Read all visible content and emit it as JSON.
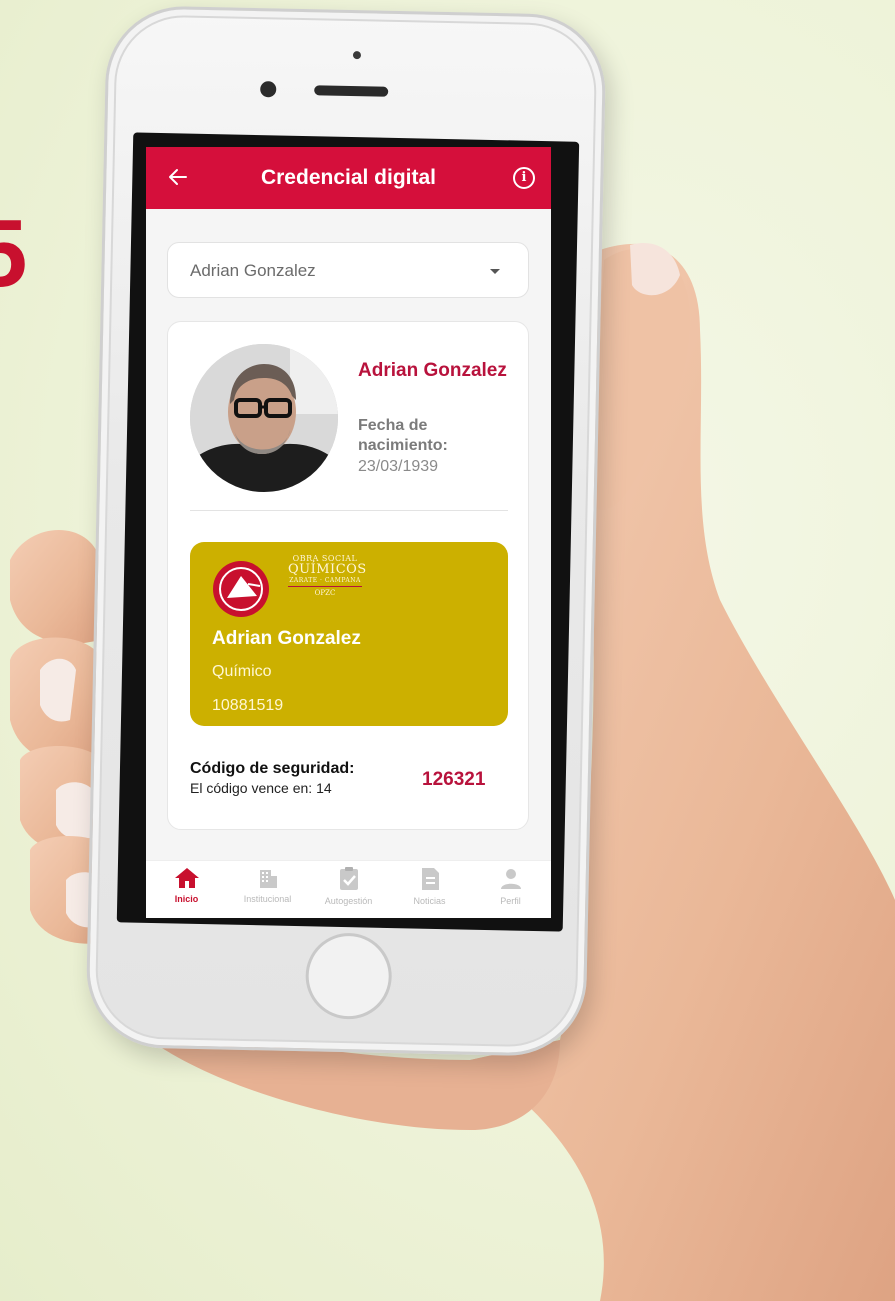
{
  "page": {
    "side_digit": "5"
  },
  "appbar": {
    "title": "Credencial digital",
    "back_icon": "arrow-left-icon",
    "info_icon": "info-icon",
    "info_glyph": "i"
  },
  "member_select": {
    "selected": "Adrian  Gonzalez"
  },
  "profile": {
    "name": "Adrian  Gonzalez",
    "dob_label": "Fecha de nacimiento:",
    "dob_value": "23/03/1939"
  },
  "credential": {
    "logo_line1": "OBRA SOCIAL",
    "logo_line2": "QUÍMICOS",
    "logo_line3": "ZARATE · CAMPANA",
    "logo_line4": "OPZC",
    "name": "Adrian  Gonzalez",
    "role": "Químico",
    "number": "10881519",
    "background_color": "#ccb000"
  },
  "security": {
    "label": "Código de seguridad:",
    "expire_text": "El código vence en: 14",
    "code": "126321"
  },
  "bottom_nav": {
    "items": [
      {
        "label": "Inicio",
        "icon": "home-icon",
        "active": true
      },
      {
        "label": "Institucional",
        "icon": "building-icon",
        "active": false
      },
      {
        "label": "Autogestión",
        "icon": "clipboard-check-icon",
        "active": false
      },
      {
        "label": "Noticias",
        "icon": "document-icon",
        "active": false
      },
      {
        "label": "Perfil",
        "icon": "person-icon",
        "active": false
      }
    ]
  },
  "colors": {
    "brand_red": "#d50f3b",
    "name_red": "#b8123c",
    "inactive_gray": "#b9b9b9"
  }
}
